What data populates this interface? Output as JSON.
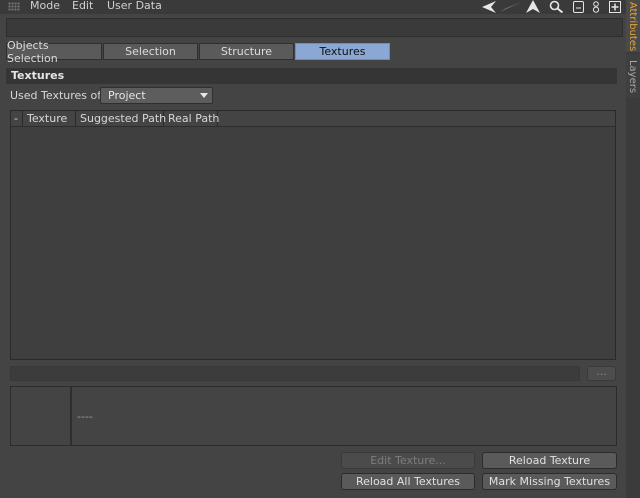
{
  "menu": {
    "items": [
      "Mode",
      "Edit",
      "User Data"
    ]
  },
  "toolbar_icons": [
    "back-arrow-icon",
    "forward-arrow-icon",
    "up-arrow-icon",
    "search-icon",
    "new-window-icon",
    "lock-icon",
    "add-icon"
  ],
  "side_tabs": {
    "attributes": "Attributes",
    "layers": "Layers"
  },
  "tabs": [
    {
      "label": "Objects Selection",
      "active": false
    },
    {
      "label": "Selection",
      "active": false
    },
    {
      "label": "Structure",
      "active": false
    },
    {
      "label": "Textures",
      "active": true
    }
  ],
  "section": {
    "title": "Textures"
  },
  "used_textures": {
    "label": "Used Textures of",
    "value": "Project"
  },
  "table": {
    "columns": [
      "-",
      "Texture",
      "Suggested Path",
      "Real Path"
    ],
    "rows": []
  },
  "path": {
    "browse_label": "..."
  },
  "preview": {
    "info": "----"
  },
  "buttons": {
    "edit": "Edit Texture...",
    "reload": "Reload Texture",
    "reload_all": "Reload All Textures",
    "mark_missing": "Mark Missing Textures"
  },
  "colors": {
    "active_tab": "#8ba7d3",
    "attributes_tab_text": "#e3a33b",
    "background": "#444444"
  }
}
